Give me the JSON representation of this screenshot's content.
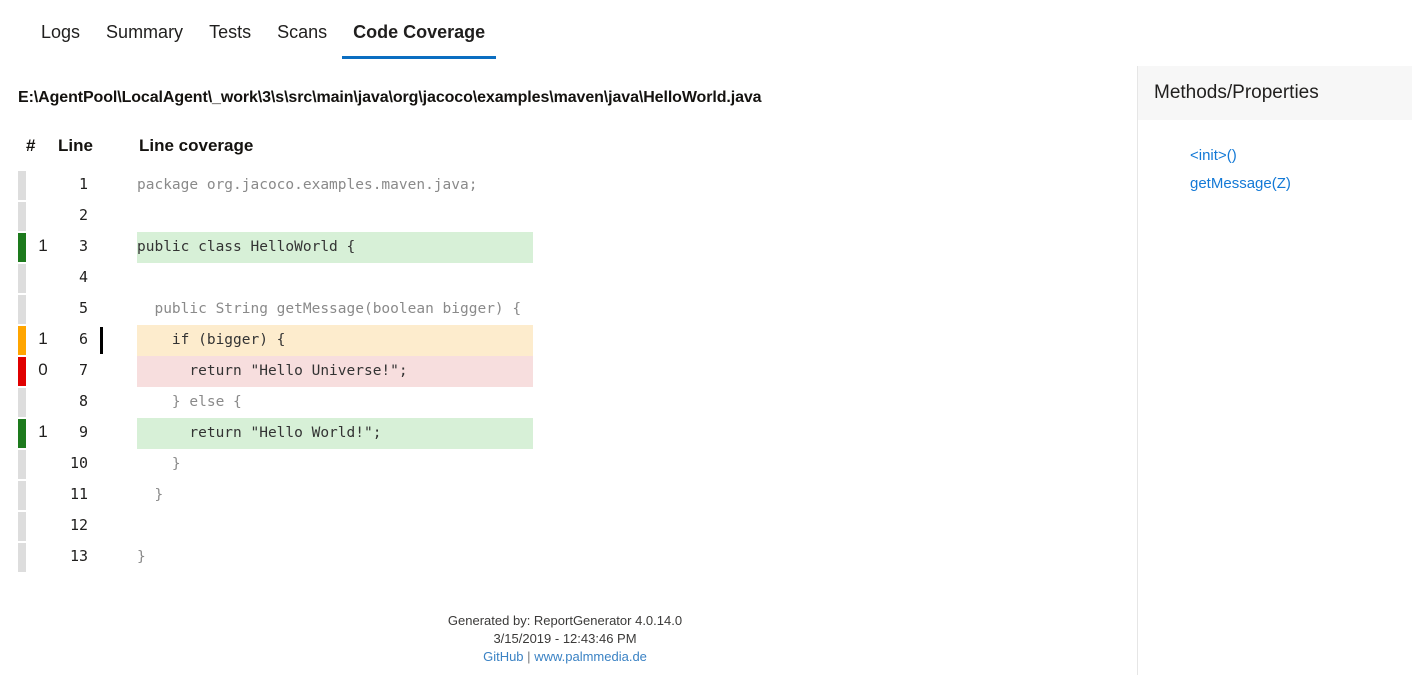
{
  "tabs": [
    {
      "label": "Logs",
      "active": false
    },
    {
      "label": "Summary",
      "active": false
    },
    {
      "label": "Tests",
      "active": false
    },
    {
      "label": "Scans",
      "active": false
    },
    {
      "label": "Code Coverage",
      "active": true
    }
  ],
  "file_path": "E:\\AgentPool\\LocalAgent\\_work\\3\\s\\src\\main\\java\\org\\jacoco\\examples\\maven\\java\\HelloWorld.java",
  "table": {
    "headers": {
      "hits": "#",
      "line": "Line",
      "coverage": "Line coverage"
    },
    "rows": [
      {
        "line": "1",
        "hits": "",
        "status": "none",
        "branch": false,
        "code": "package org.jacoco.examples.maven.java;"
      },
      {
        "line": "2",
        "hits": "",
        "status": "none",
        "branch": false,
        "code": ""
      },
      {
        "line": "3",
        "hits": "1",
        "status": "full",
        "branch": false,
        "code": "public class HelloWorld {"
      },
      {
        "line": "4",
        "hits": "",
        "status": "none",
        "branch": false,
        "code": ""
      },
      {
        "line": "5",
        "hits": "",
        "status": "none",
        "branch": false,
        "code": "  public String getMessage(boolean bigger) {"
      },
      {
        "line": "6",
        "hits": "1",
        "status": "partial",
        "branch": true,
        "code": "    if (bigger) {"
      },
      {
        "line": "7",
        "hits": "0",
        "status": "zero",
        "branch": false,
        "code": "      return \"Hello Universe!\";"
      },
      {
        "line": "8",
        "hits": "",
        "status": "none",
        "branch": false,
        "code": "    } else {"
      },
      {
        "line": "9",
        "hits": "1",
        "status": "full",
        "branch": false,
        "code": "      return \"Hello World!\";"
      },
      {
        "line": "10",
        "hits": "",
        "status": "none",
        "branch": false,
        "code": "    }"
      },
      {
        "line": "11",
        "hits": "",
        "status": "none",
        "branch": false,
        "code": "  }"
      },
      {
        "line": "12",
        "hits": "",
        "status": "none",
        "branch": false,
        "code": ""
      },
      {
        "line": "13",
        "hits": "",
        "status": "none",
        "branch": false,
        "code": "}"
      }
    ]
  },
  "sidebar": {
    "title": "Methods/Properties",
    "items": [
      {
        "label": "<init>()"
      },
      {
        "label": "getMessage(Z)"
      }
    ]
  },
  "footer": {
    "generated_by": "Generated by: ReportGenerator 4.0.14.0",
    "timestamp": "3/15/2019 - 12:43:46 PM",
    "github_link": "GitHub",
    "separator": "|",
    "site_link": "www.palmmedia.de"
  },
  "colors": {
    "accent": "#0b6ec1",
    "covered": "#1d7a1d",
    "partial": "#ffa500",
    "uncovered": "#e00000",
    "neutral": "#dddddd",
    "link": "#1379d6"
  }
}
